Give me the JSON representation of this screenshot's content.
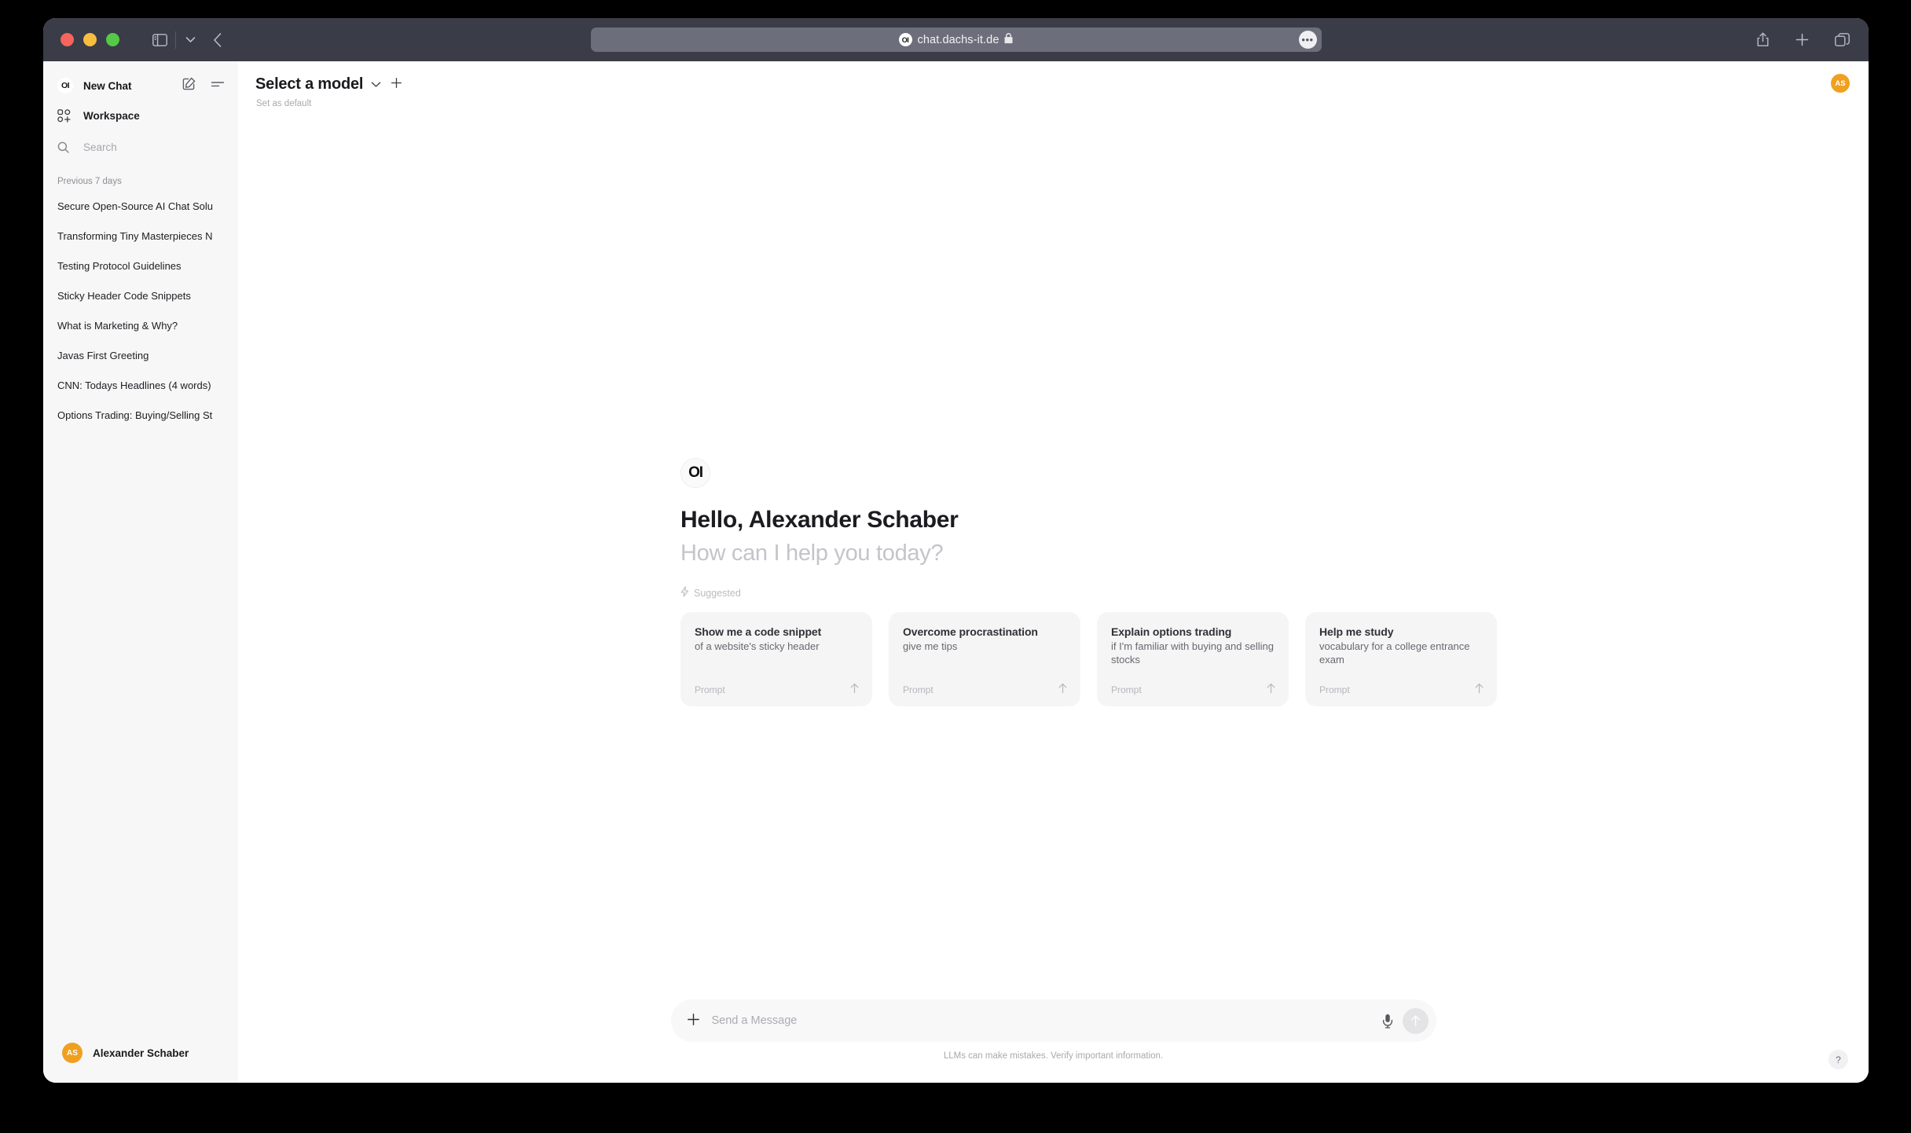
{
  "browser": {
    "url": "chat.dachs-it.de",
    "favicon_label": "OI",
    "lock_glyph": "🔒",
    "more_glyph": "•••",
    "icons": {
      "sidebar_toggle": "sidebar-toggle-icon",
      "tab_chevron": "chevron-down-icon",
      "back": "back-arrow-icon",
      "share": "share-icon",
      "new_tab": "plus-icon",
      "tab_overview": "tab-overview-icon"
    }
  },
  "sidebar": {
    "brand_badge": "OI",
    "new_chat_label": "New Chat",
    "workspace_label": "Workspace",
    "search_placeholder": "Search",
    "search_value": "",
    "section_label": "Previous 7 days",
    "chats": [
      "Secure Open-Source AI Chat Solu",
      "Transforming Tiny Masterpieces N",
      "Testing Protocol Guidelines",
      "Sticky Header Code Snippets",
      "What is Marketing & Why?",
      "Javas First Greeting",
      "CNN: Todays Headlines (4 words)",
      "Options Trading: Buying/Selling St"
    ],
    "user": {
      "initials": "AS",
      "name": "Alexander Schaber"
    }
  },
  "main": {
    "model_selector_label": "Select a model",
    "set_as_default_label": "Set as default",
    "hero_logo": "OI",
    "greeting": "Hello, Alexander Schaber",
    "subgreeting": "How can I help you today?",
    "suggested_label": "Suggested",
    "cards": [
      {
        "title": "Show me a code snippet",
        "subtitle": "of a website's sticky header",
        "footer": "Prompt"
      },
      {
        "title": "Overcome procrastination",
        "subtitle": "give me tips",
        "footer": "Prompt"
      },
      {
        "title": "Explain options trading",
        "subtitle": "if I'm familiar with buying and selling stocks",
        "footer": "Prompt"
      },
      {
        "title": "Help me study",
        "subtitle": "vocabulary for a college entrance exam",
        "footer": "Prompt"
      }
    ],
    "composer_placeholder": "Send a Message",
    "composer_value": "",
    "disclaimer": "LLMs can make mistakes. Verify important information.",
    "help_label": "?",
    "top_avatar": "AS"
  },
  "colors": {
    "accent_orange": "#f0a020",
    "toolbar_bg": "#3a3c48",
    "sidebar_bg": "#f7f7f8",
    "card_bg": "#f5f5f6"
  }
}
